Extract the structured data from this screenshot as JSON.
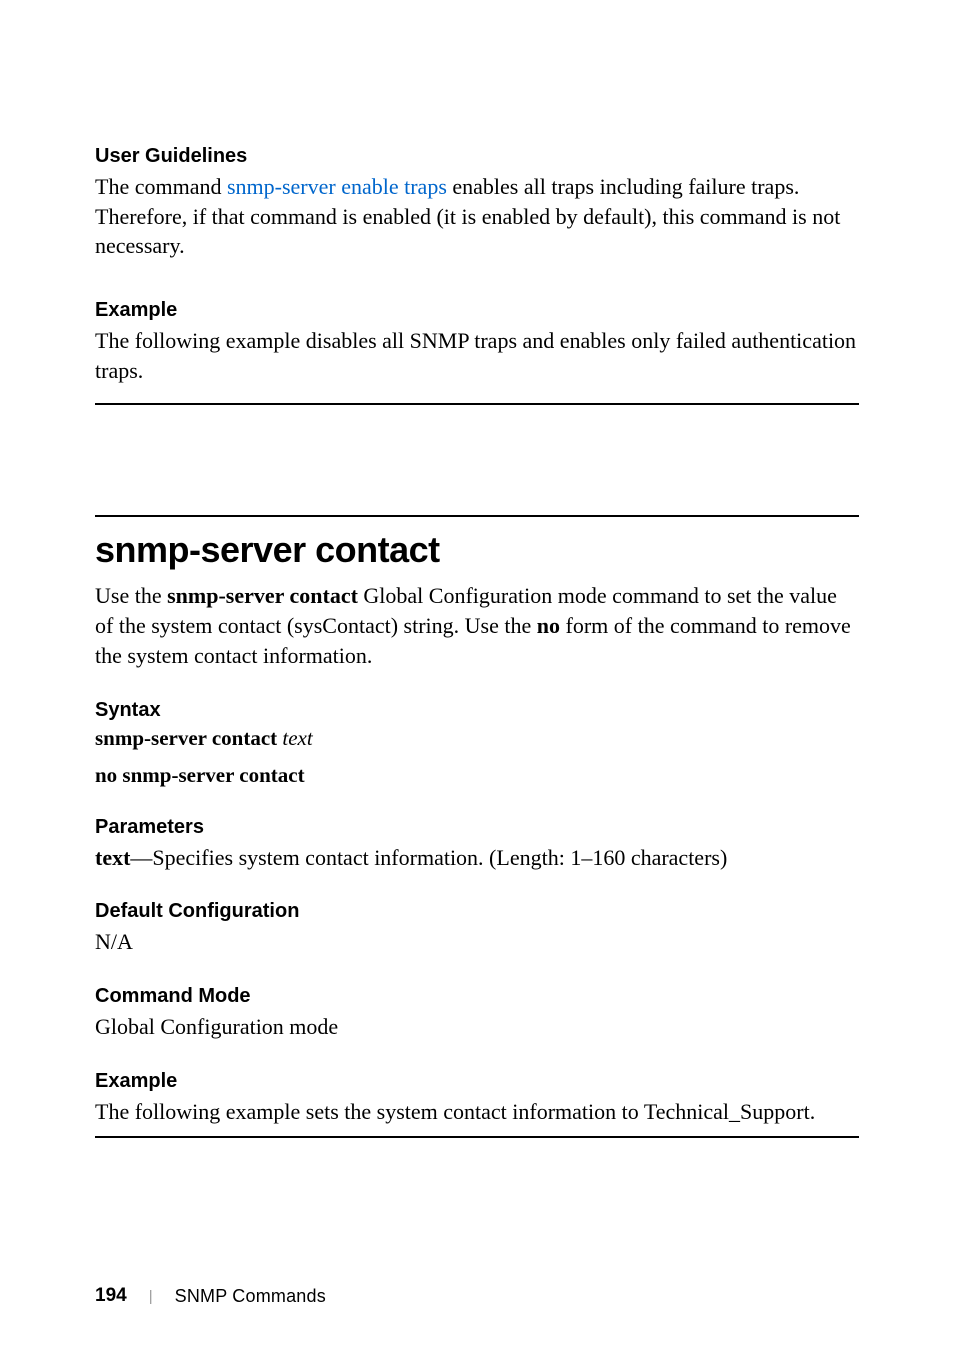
{
  "userGuidelines": {
    "heading": "User Guidelines",
    "line1_prefix": "The command ",
    "line1_link": "snmp-server enable traps",
    "line1_suffix": " enables all traps including failure traps. Therefore, if that command is enabled (it is enabled by default), this command is not necessary."
  },
  "example1": {
    "heading": "Example",
    "text": "The following example disables all SNMP traps and enables only failed authentication traps."
  },
  "sectionTitle": "snmp-server contact",
  "intro": {
    "prefix": "Use the ",
    "bold1": "snmp-server contact",
    "mid": " Global Configuration mode command to set the value of the system contact (sysContact) string. Use the ",
    "bold2": "no",
    "suffix": " form of the command to remove the system contact information."
  },
  "syntax": {
    "heading": "Syntax",
    "line1_bold": "snmp-server contact",
    "line1_italic": "text",
    "line2_bold": "no snmp-server contact"
  },
  "parameters": {
    "heading": "Parameters",
    "bold": "text",
    "rest": "—Specifies system contact information. (Length: 1–160 characters)"
  },
  "defaultConfig": {
    "heading": "Default Configuration",
    "text": "N/A"
  },
  "commandMode": {
    "heading": "Command Mode",
    "text": "Global Configuration mode"
  },
  "example2": {
    "heading": "Example",
    "text": "The following example sets the system contact information to Technical_Support."
  },
  "footer": {
    "page": "194",
    "sep": "|",
    "chapter": "SNMP Commands"
  }
}
